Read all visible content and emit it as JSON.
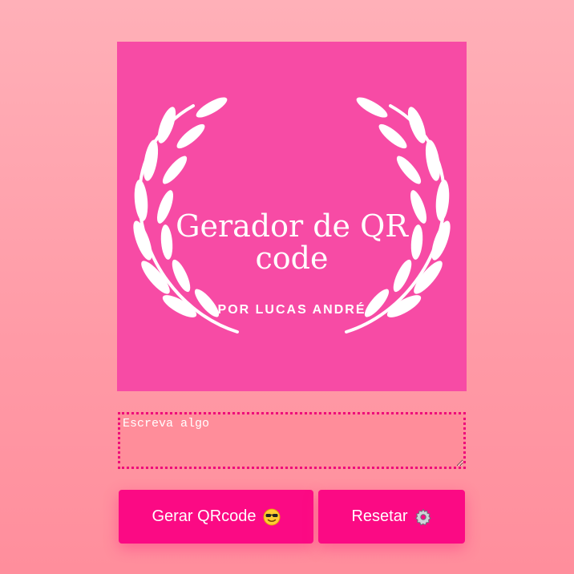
{
  "logo": {
    "title_line1": "Gerador de QR",
    "title_line2": "code",
    "subtitle": "POR LUCAS ANDRÉ"
  },
  "input": {
    "placeholder": "Escreva algo",
    "value": ""
  },
  "buttons": {
    "generate_label": "Gerar QRcode",
    "generate_icon": "sunglasses-face-emoji",
    "reset_label": "Resetar",
    "reset_icon": "gear-emoji"
  },
  "colors": {
    "background": "#ffa5b0",
    "logo_bg": "#f74ba5",
    "accent": "#fb0a84",
    "input_bg": "#ff8d9a"
  }
}
